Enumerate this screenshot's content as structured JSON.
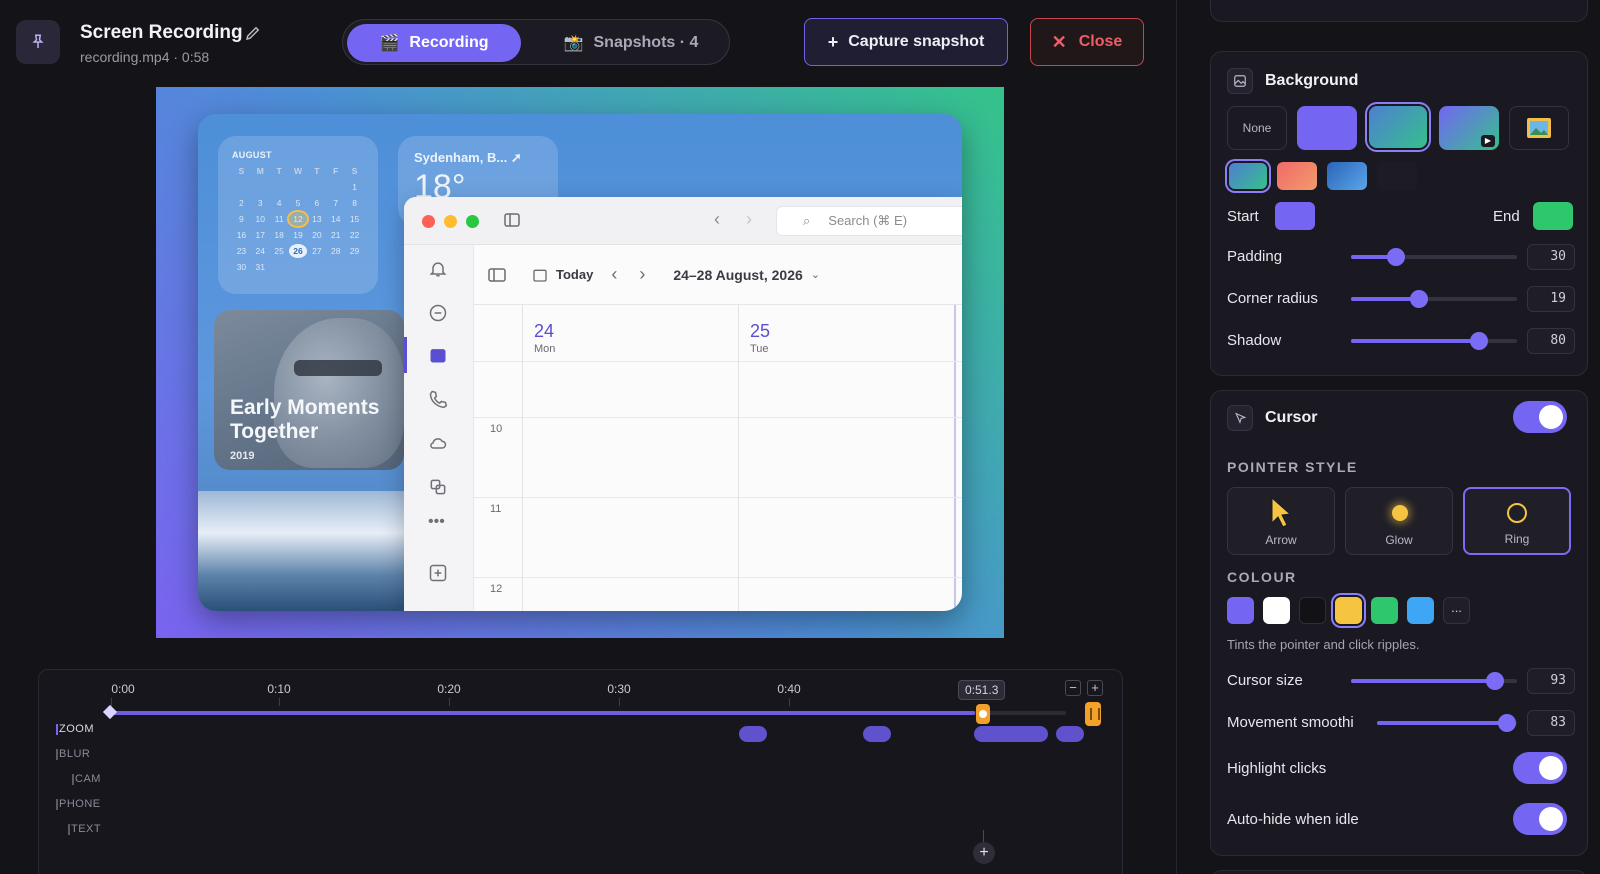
{
  "header": {
    "title": "Screen Recording",
    "subtitle": "recording.mp4 · 0:58",
    "tabs": [
      {
        "label": "Recording",
        "icon": "clapper-icon",
        "active": true
      },
      {
        "label": "Snapshots · 4",
        "icon": "camera-icon",
        "active": false
      }
    ],
    "capture_label": "Capture snapshot",
    "close_label": "Close"
  },
  "preview": {
    "calendar_widget": {
      "month": "AUGUST",
      "weekdays": [
        "S",
        "M",
        "T",
        "W",
        "T",
        "F",
        "S"
      ],
      "days": [
        "",
        "",
        "",
        "",
        "",
        "",
        "1",
        "2",
        "3",
        "4",
        "5",
        "6",
        "7",
        "8",
        "9",
        "10",
        "11",
        "12",
        "13",
        "14",
        "15",
        "16",
        "17",
        "18",
        "19",
        "20",
        "21",
        "22",
        "23",
        "24",
        "25",
        "26",
        "27",
        "28",
        "29",
        "30",
        "31"
      ],
      "today": "26",
      "cursor_day": "12"
    },
    "weather_widget": {
      "location": "Sydenham, B...",
      "temp": "18°"
    },
    "photo_widget": {
      "caption": "Early Moments Together",
      "year": "2019"
    },
    "app": {
      "search_placeholder": "Search (⌘ E)",
      "today_label": "Today",
      "date_range": "24–28 August, 2026",
      "days": [
        {
          "num": "24",
          "name": "Mon"
        },
        {
          "num": "25",
          "name": "Tue"
        }
      ],
      "hours": [
        "10",
        "11",
        "12"
      ]
    }
  },
  "timeline": {
    "ticks": [
      "0:00",
      "0:10",
      "0:20",
      "0:30",
      "0:40"
    ],
    "cursor_time": "0:51.3",
    "lanes": [
      "ZOOM",
      "BLUR",
      "CAM",
      "PHONE",
      "TEXT"
    ]
  },
  "background": {
    "title": "Background",
    "none_label": "None",
    "start_label": "Start",
    "end_label": "End",
    "start_color": "#7466f2",
    "end_color": "#2fc76d",
    "padding": {
      "label": "Padding",
      "value": 30,
      "fraction": 0.27
    },
    "corner_radius": {
      "label": "Corner radius",
      "value": 19,
      "fraction": 0.41
    },
    "shadow": {
      "label": "Shadow",
      "value": 80,
      "fraction": 0.77
    }
  },
  "cursor": {
    "title": "Cursor",
    "pointer_style_label": "POINTER STYLE",
    "pointer_styles": [
      "Arrow",
      "Glow",
      "Ring"
    ],
    "selected_style": "Ring",
    "colour_label": "COLOUR",
    "colours": [
      "#7466f2",
      "#ffffff",
      "#121216",
      "#f5c542",
      "#2fc76d",
      "#3ea6f5"
    ],
    "selected_colour": "#f5c542",
    "more_label": "...",
    "hint": "Tints the pointer and click ripples.",
    "cursor_size": {
      "label": "Cursor size",
      "value": 93,
      "fraction": 0.87
    },
    "smoothing": {
      "label": "Movement smoothi",
      "value": 83,
      "fraction": 0.93
    },
    "highlight_clicks": "Highlight clicks",
    "auto_hide": "Auto-hide when idle"
  }
}
